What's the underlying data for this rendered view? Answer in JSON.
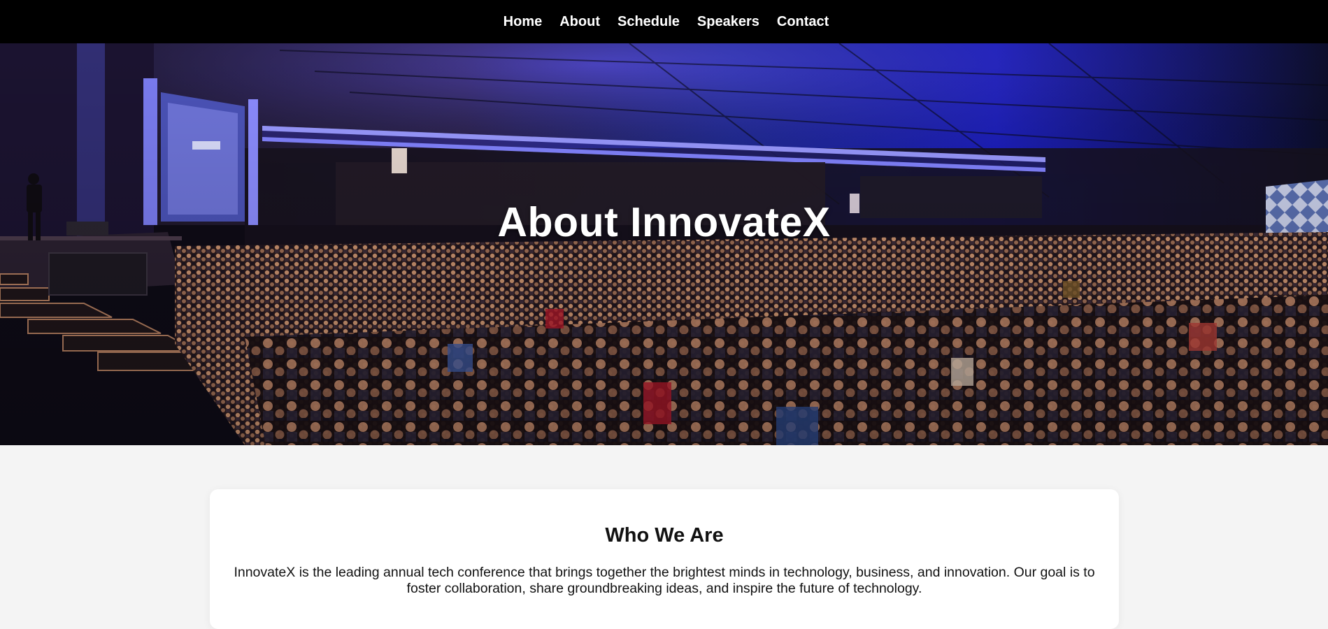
{
  "nav": {
    "items": [
      {
        "label": "Home"
      },
      {
        "label": "About"
      },
      {
        "label": "Schedule"
      },
      {
        "label": "Speakers"
      },
      {
        "label": "Contact"
      }
    ]
  },
  "hero": {
    "title": "About InnovateX",
    "image_description": "conference-hall-crowd-photo"
  },
  "about": {
    "heading": "Who We Are",
    "body": "InnovateX is the leading annual tech conference that brings together the brightest minds in technology, business, and innovation. Our goal is to foster collaboration, share groundbreaking ideas, and inspire the future of technology."
  },
  "colors": {
    "nav_bg": "#000000",
    "nav_text": "#ffffff",
    "page_bg": "#f4f4f4",
    "card_bg": "#ffffff",
    "accent_stage_light": "#3a3cff"
  }
}
